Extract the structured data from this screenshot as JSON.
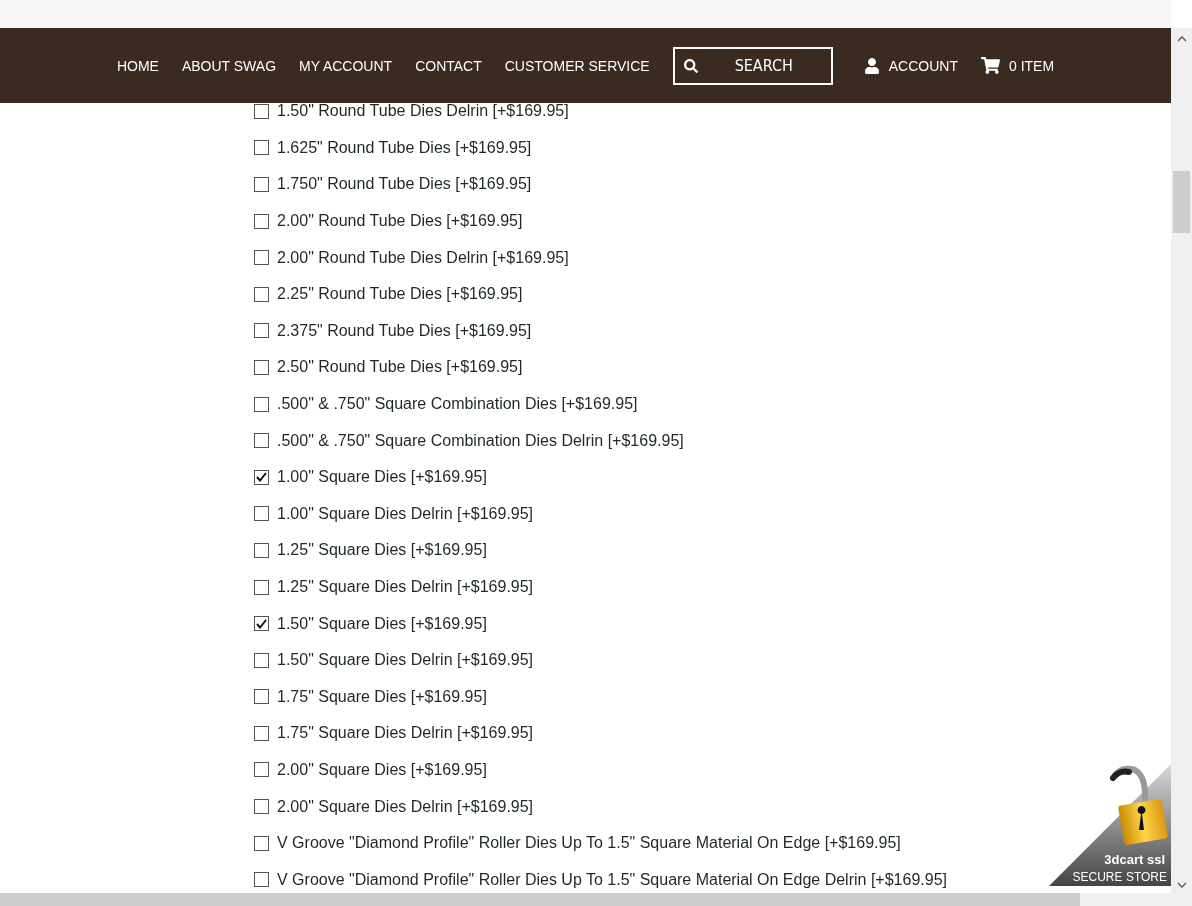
{
  "nav": {
    "links": [
      "HOME",
      "ABOUT SWAG",
      "MY ACCOUNT",
      "CONTACT",
      "CUSTOMER SERVICE"
    ],
    "search": {
      "placeholder": "SEARCH"
    },
    "account": "ACCOUNT",
    "cart": "0 ITEM"
  },
  "options": [
    {
      "label": "1.50\" Round Tube Dies Delrin [+$169.95]",
      "checked": false
    },
    {
      "label": "1.625\" Round Tube Dies [+$169.95]",
      "checked": false
    },
    {
      "label": "1.750\" Round Tube Dies [+$169.95]",
      "checked": false
    },
    {
      "label": "2.00\" Round Tube Dies [+$169.95]",
      "checked": false
    },
    {
      "label": "2.00\" Round Tube Dies Delrin [+$169.95]",
      "checked": false
    },
    {
      "label": "2.25\" Round Tube Dies [+$169.95]",
      "checked": false
    },
    {
      "label": "2.375\" Round Tube Dies [+$169.95]",
      "checked": false
    },
    {
      "label": "2.50\" Round Tube Dies [+$169.95]",
      "checked": false
    },
    {
      "label": ".500\" & .750\" Square Combination Dies [+$169.95]",
      "checked": false
    },
    {
      "label": ".500\" & .750\" Square Combination Dies Delrin [+$169.95]",
      "checked": false
    },
    {
      "label": "1.00\" Square Dies [+$169.95]",
      "checked": true
    },
    {
      "label": "1.00\" Square Dies Delrin [+$169.95]",
      "checked": false
    },
    {
      "label": "1.25\" Square Dies [+$169.95]",
      "checked": false
    },
    {
      "label": "1.25\" Square Dies Delrin [+$169.95]",
      "checked": false
    },
    {
      "label": "1.50\" Square Dies [+$169.95]",
      "checked": true
    },
    {
      "label": "1.50\" Square Dies Delrin [+$169.95]",
      "checked": false
    },
    {
      "label": "1.75\" Square Dies [+$169.95]",
      "checked": false
    },
    {
      "label": "1.75\" Square Dies Delrin [+$169.95]",
      "checked": false
    },
    {
      "label": "2.00\" Square Dies [+$169.95]",
      "checked": false
    },
    {
      "label": "2.00\" Square Dies Delrin [+$169.95]",
      "checked": false
    },
    {
      "label": "V Groove \"Diamond Profile\" Roller Dies Up To 1.5\" Square Material On Edge [+$169.95]",
      "checked": false
    },
    {
      "label": "V Groove \"Diamond Profile\" Roller Dies Up To 1.5\" Square Material On Edge Delrin [+$169.95]",
      "checked": false
    }
  ],
  "badge": {
    "brand": "3dcart ssl",
    "caption": "SECURE STORE"
  }
}
